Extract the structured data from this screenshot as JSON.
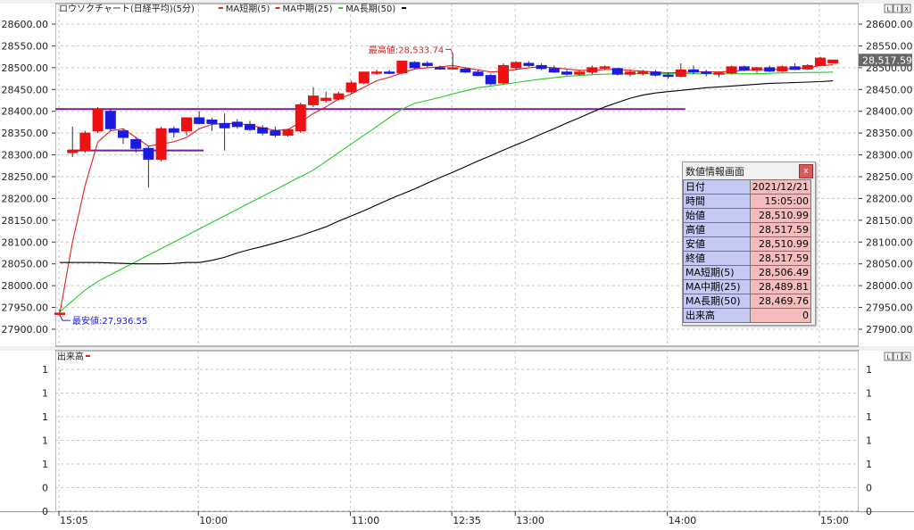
{
  "upper_legend": {
    "title": "ロウソクチャート(日経平均)(5分)",
    "items": [
      {
        "label": "MA短期(5)",
        "color": "#e02020"
      },
      {
        "label": "MA中期(25)",
        "color": "#e02020"
      },
      {
        "label": "MA長期(50)",
        "color": "#22cc22"
      },
      {
        "label": "",
        "color": "#000000"
      }
    ]
  },
  "lower_legend": {
    "title": "出来高",
    "color": "#e02020"
  },
  "pane_buttons": [
    "L",
    "I",
    "X"
  ],
  "price_badge": "28,517.59",
  "annotations": {
    "high": "最高値:28,533.74",
    "low": "最安値:27,936.55"
  },
  "info_panel": {
    "title": "数値情報画面",
    "close": "x",
    "rows": [
      {
        "label": "日付",
        "value": "2021/12/21"
      },
      {
        "label": "時間",
        "value": "15:05:00"
      },
      {
        "label": "始値",
        "value": "28,510.99"
      },
      {
        "label": "高値",
        "value": "28,517.59"
      },
      {
        "label": "安値",
        "value": "28,510.99"
      },
      {
        "label": "終値",
        "value": "28,517.59"
      },
      {
        "label": "MA短期(5)",
        "value": "28,506.49"
      },
      {
        "label": "MA中期(25)",
        "value": "28,489.81"
      },
      {
        "label": "MA長期(50)",
        "value": "28,469.76"
      },
      {
        "label": "出来高",
        "value": "0"
      }
    ]
  },
  "colors": {
    "up": "#ee1111",
    "down": "#1a1ae0",
    "ma_short": "#e02020",
    "ma_mid": "#22cc22",
    "ma_long": "#000000",
    "hline": "#7a1a9a"
  },
  "chart_data": {
    "type": "candlestick",
    "ylim": [
      27880,
      28620
    ],
    "yticks": [
      "28600.00",
      "28550.00",
      "28500.00",
      "28450.00",
      "28400.00",
      "28350.00",
      "28300.00",
      "28250.00",
      "28200.00",
      "28150.00",
      "28100.00",
      "28050.00",
      "28000.00",
      "27950.00",
      "27900.00"
    ],
    "ytick_values": [
      28600,
      28550,
      28500,
      28450,
      28400,
      28350,
      28300,
      28250,
      28200,
      28150,
      28100,
      28050,
      28000,
      27950,
      27900
    ],
    "right_yticks": [
      "28600.00",
      "28550.00",
      "28500.00",
      "28450.00",
      "28400.00",
      "28350.00",
      "28300.00",
      "28250.00",
      "28200.00",
      "28150.00",
      "28100.00",
      "28050.00",
      "28000.00",
      "27950.00",
      "27900.00"
    ],
    "xticks": [
      {
        "label": "15:05",
        "index": 0
      },
      {
        "label": "10:00",
        "index": 11
      },
      {
        "label": "11:00",
        "index": 23
      },
      {
        "label": "12:35",
        "index": 31
      },
      {
        "label": "13:00",
        "index": 36
      },
      {
        "label": "14:00",
        "index": 48
      },
      {
        "label": "15:00",
        "index": 60
      }
    ],
    "candles": [
      {
        "o": 27937,
        "h": 27945,
        "l": 27937,
        "c": 27937
      },
      {
        "o": 28305,
        "h": 28365,
        "l": 28295,
        "c": 28310
      },
      {
        "o": 28310,
        "h": 28355,
        "l": 28305,
        "c": 28350
      },
      {
        "o": 28355,
        "h": 28410,
        "l": 28350,
        "c": 28405
      },
      {
        "o": 28400,
        "h": 28405,
        "l": 28355,
        "c": 28360
      },
      {
        "o": 28355,
        "h": 28360,
        "l": 28325,
        "c": 28340
      },
      {
        "o": 28335,
        "h": 28340,
        "l": 28305,
        "c": 28315
      },
      {
        "o": 28315,
        "h": 28320,
        "l": 28225,
        "c": 28290
      },
      {
        "o": 28290,
        "h": 28365,
        "l": 28285,
        "c": 28360
      },
      {
        "o": 28360,
        "h": 28365,
        "l": 28340,
        "c": 28352
      },
      {
        "o": 28355,
        "h": 28385,
        "l": 28345,
        "c": 28385
      },
      {
        "o": 28385,
        "h": 28400,
        "l": 28370,
        "c": 28372
      },
      {
        "o": 28380,
        "h": 28385,
        "l": 28355,
        "c": 28372
      },
      {
        "o": 28372,
        "h": 28395,
        "l": 28310,
        "c": 28362
      },
      {
        "o": 28375,
        "h": 28382,
        "l": 28360,
        "c": 28365
      },
      {
        "o": 28370,
        "h": 28378,
        "l": 28355,
        "c": 28358
      },
      {
        "o": 28362,
        "h": 28368,
        "l": 28345,
        "c": 28350
      },
      {
        "o": 28355,
        "h": 28365,
        "l": 28340,
        "c": 28345
      },
      {
        "o": 28345,
        "h": 28360,
        "l": 28342,
        "c": 28358
      },
      {
        "o": 28355,
        "h": 28420,
        "l": 28350,
        "c": 28415
      },
      {
        "o": 28415,
        "h": 28455,
        "l": 28410,
        "c": 28435
      },
      {
        "o": 28425,
        "h": 28445,
        "l": 28420,
        "c": 28430
      },
      {
        "o": 28428,
        "h": 28445,
        "l": 28425,
        "c": 28440
      },
      {
        "o": 28445,
        "h": 28470,
        "l": 28440,
        "c": 28465
      },
      {
        "o": 28465,
        "h": 28490,
        "l": 28462,
        "c": 28490
      },
      {
        "o": 28490,
        "h": 28495,
        "l": 28483,
        "c": 28490
      },
      {
        "o": 28490,
        "h": 28495,
        "l": 28485,
        "c": 28488
      },
      {
        "o": 28488,
        "h": 28515,
        "l": 28485,
        "c": 28515
      },
      {
        "o": 28512,
        "h": 28515,
        "l": 28497,
        "c": 28500
      },
      {
        "o": 28510,
        "h": 28515,
        "l": 28500,
        "c": 28505
      },
      {
        "o": 28500,
        "h": 28505,
        "l": 28495,
        "c": 28498
      },
      {
        "o": 28498,
        "h": 28533.74,
        "l": 28495,
        "c": 28500
      },
      {
        "o": 28497,
        "h": 28500,
        "l": 28488,
        "c": 28490
      },
      {
        "o": 28490,
        "h": 28495,
        "l": 28480,
        "c": 28482
      },
      {
        "o": 28482,
        "h": 28486,
        "l": 28460,
        "c": 28463
      },
      {
        "o": 28465,
        "h": 28510,
        "l": 28462,
        "c": 28505
      },
      {
        "o": 28500,
        "h": 28515,
        "l": 28495,
        "c": 28512
      },
      {
        "o": 28510,
        "h": 28515,
        "l": 28502,
        "c": 28505
      },
      {
        "o": 28505,
        "h": 28510,
        "l": 28495,
        "c": 28498
      },
      {
        "o": 28498,
        "h": 28505,
        "l": 28488,
        "c": 28490
      },
      {
        "o": 28490,
        "h": 28495,
        "l": 28482,
        "c": 28485
      },
      {
        "o": 28485,
        "h": 28495,
        "l": 28482,
        "c": 28490
      },
      {
        "o": 28490,
        "h": 28505,
        "l": 28485,
        "c": 28500
      },
      {
        "o": 28500,
        "h": 28505,
        "l": 28495,
        "c": 28502
      },
      {
        "o": 28498,
        "h": 28500,
        "l": 28482,
        "c": 28485
      },
      {
        "o": 28485,
        "h": 28495,
        "l": 28480,
        "c": 28490
      },
      {
        "o": 28488,
        "h": 28495,
        "l": 28482,
        "c": 28490
      },
      {
        "o": 28490,
        "h": 28495,
        "l": 28480,
        "c": 28483
      },
      {
        "o": 28483,
        "h": 28490,
        "l": 28475,
        "c": 28480
      },
      {
        "o": 28480,
        "h": 28510,
        "l": 28478,
        "c": 28495
      },
      {
        "o": 28495,
        "h": 28505,
        "l": 28485,
        "c": 28490
      },
      {
        "o": 28490,
        "h": 28495,
        "l": 28480,
        "c": 28487
      },
      {
        "o": 28485,
        "h": 28490,
        "l": 28478,
        "c": 28488
      },
      {
        "o": 28488,
        "h": 28505,
        "l": 28485,
        "c": 28502
      },
      {
        "o": 28502,
        "h": 28505,
        "l": 28492,
        "c": 28495
      },
      {
        "o": 28495,
        "h": 28502,
        "l": 28488,
        "c": 28500
      },
      {
        "o": 28500,
        "h": 28505,
        "l": 28490,
        "c": 28492
      },
      {
        "o": 28492,
        "h": 28505,
        "l": 28490,
        "c": 28502
      },
      {
        "o": 28502,
        "h": 28510,
        "l": 28495,
        "c": 28496
      },
      {
        "o": 28497,
        "h": 28508,
        "l": 28495,
        "c": 28505
      },
      {
        "o": 28505,
        "h": 28525,
        "l": 28503,
        "c": 28522
      },
      {
        "o": 28510.99,
        "h": 28517.59,
        "l": 28510.99,
        "c": 28517.59
      }
    ],
    "series": [
      {
        "name": "MA短期(5)",
        "color": "#e02020",
        "values": [
          27937,
          28100,
          28230,
          28330,
          28355,
          28360,
          28340,
          28320,
          28325,
          28330,
          28340,
          28360,
          28370,
          28372,
          28372,
          28368,
          28362,
          28356,
          28358,
          28375,
          28395,
          28410,
          28428,
          28440,
          28455,
          28470,
          28478,
          28488,
          28497,
          28500,
          28502,
          28505,
          28500,
          28495,
          28490,
          28492,
          28496,
          28500,
          28502,
          28500,
          28497,
          28494,
          28494,
          28496,
          28496,
          28494,
          28492,
          28490,
          28488,
          28489,
          28490,
          28491,
          28490,
          28492,
          28494,
          28495,
          28496,
          28497,
          28498,
          28500,
          28505,
          28506.49
        ]
      },
      {
        "name": "MA中期(25)",
        "color": "#22cc22",
        "values": [
          27940,
          27965,
          27990,
          28010,
          28025,
          28040,
          28055,
          28070,
          28085,
          28100,
          28115,
          28130,
          28145,
          28160,
          28175,
          28190,
          28205,
          28220,
          28235,
          28250,
          28265,
          28285,
          28305,
          28325,
          28345,
          28365,
          28385,
          28405,
          28418,
          28425,
          28432,
          28440,
          28447,
          28454,
          28458,
          28462,
          28466,
          28470,
          28474,
          28477,
          28480,
          28482,
          28484,
          28485,
          28486,
          28486,
          28486,
          28486,
          28486,
          28486,
          28486,
          28486,
          28486,
          28486,
          28486,
          28486,
          28487,
          28488,
          28488,
          28489,
          28489,
          28489.81
        ]
      },
      {
        "name": "MA長期(50)",
        "color": "#000000",
        "values": [
          28053,
          28053,
          28053,
          28053,
          28052,
          28051,
          28050,
          28050,
          28050,
          28051,
          28053,
          28053,
          28058,
          28065,
          28075,
          28083,
          28090,
          28098,
          28106,
          28115,
          28125,
          28135,
          28148,
          28160,
          28172,
          28185,
          28198,
          28210,
          28222,
          28235,
          28248,
          28260,
          28273,
          28286,
          28298,
          28311,
          28323,
          28335,
          28348,
          28360,
          28373,
          28385,
          28398,
          28410,
          28420,
          28430,
          28437,
          28442,
          28445,
          28448,
          28451,
          28454,
          28456,
          28458,
          28460,
          28462,
          28464,
          28465,
          28466,
          28467,
          28468,
          28469.76
        ]
      }
    ],
    "hlines": [
      {
        "value": 28405,
        "from_index": 0,
        "to_index": 49
      },
      {
        "value": 28310,
        "from_index": 1,
        "to_index": 11
      }
    ],
    "volume": {
      "title": "出来高",
      "yticks": [
        "1",
        "1",
        "1",
        "1",
        "1",
        "0",
        "0",
        "0"
      ],
      "values": []
    }
  }
}
